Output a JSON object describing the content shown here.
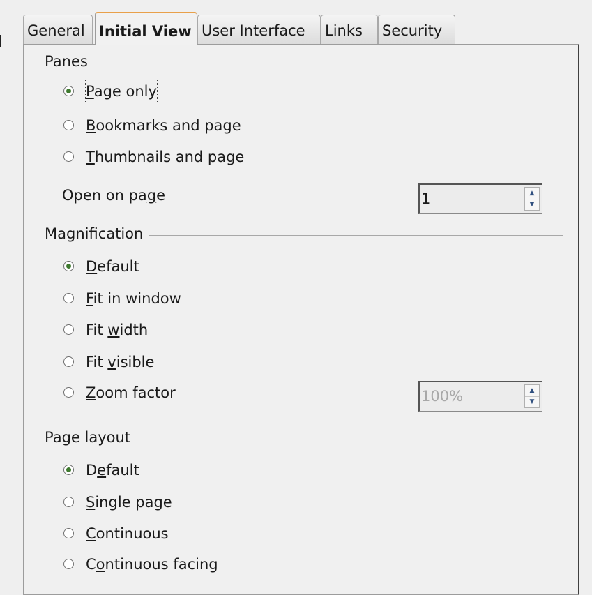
{
  "tabs": [
    {
      "label": "General",
      "active": false
    },
    {
      "label": "Initial View",
      "active": true
    },
    {
      "label": "User Interface",
      "active": false
    },
    {
      "label": "Links",
      "active": false
    },
    {
      "label": "Security",
      "active": false
    }
  ],
  "panes": {
    "title": "Panes",
    "options": [
      {
        "pre": "",
        "key": "P",
        "post": "age only",
        "checked": true
      },
      {
        "pre": "",
        "key": "B",
        "post": "ookmarks and page",
        "checked": false
      },
      {
        "pre": "",
        "key": "T",
        "post": "humbnails and page",
        "checked": false
      }
    ],
    "open_on_page": {
      "pre": "Open on pa",
      "key": "g",
      "post": "e",
      "value": "1"
    }
  },
  "magnification": {
    "title": "Magnification",
    "options": [
      {
        "pre": "",
        "key": "D",
        "post": "efault",
        "checked": true
      },
      {
        "pre": "",
        "key": "F",
        "post": "it in window",
        "checked": false
      },
      {
        "pre": "Fit ",
        "key": "w",
        "post": "idth",
        "checked": false
      },
      {
        "pre": "Fit ",
        "key": "v",
        "post": "isible",
        "checked": false
      },
      {
        "pre": "",
        "key": "Z",
        "post": "oom factor",
        "checked": false
      }
    ],
    "zoom_value": "100%"
  },
  "page_layout": {
    "title": "Page layout",
    "options": [
      {
        "pre": "D",
        "key": "e",
        "post": "fault",
        "checked": true
      },
      {
        "pre": "",
        "key": "S",
        "post": "ingle page",
        "checked": false
      },
      {
        "pre": "",
        "key": "C",
        "post": "ontinuous",
        "checked": false
      },
      {
        "pre": "C",
        "key": "o",
        "post": "ntinuous facing",
        "checked": false
      }
    ]
  },
  "icons": {
    "radio_selected_color": "#3f7a2f",
    "spin_up": "▲",
    "spin_down": "▼"
  }
}
